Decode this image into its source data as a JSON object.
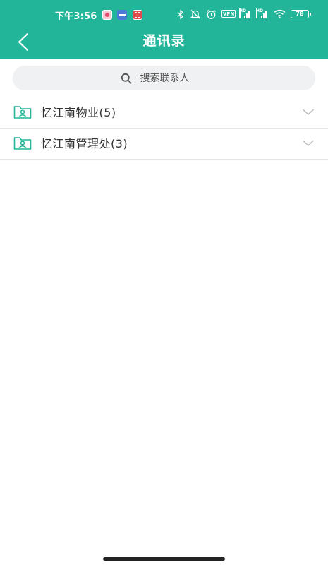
{
  "status_bar": {
    "time": "下午3:56",
    "vpn": "VPN",
    "signal_label": "HD",
    "battery": "78"
  },
  "header": {
    "title": "通讯录"
  },
  "search": {
    "placeholder": "搜索联系人"
  },
  "groups": [
    {
      "label": "忆江南物业(5)"
    },
    {
      "label": "忆江南管理处(3)"
    }
  ],
  "colors": {
    "brand": "#22b59a",
    "icon_accent": "#22b59a",
    "chevron": "#b9b9b9"
  }
}
